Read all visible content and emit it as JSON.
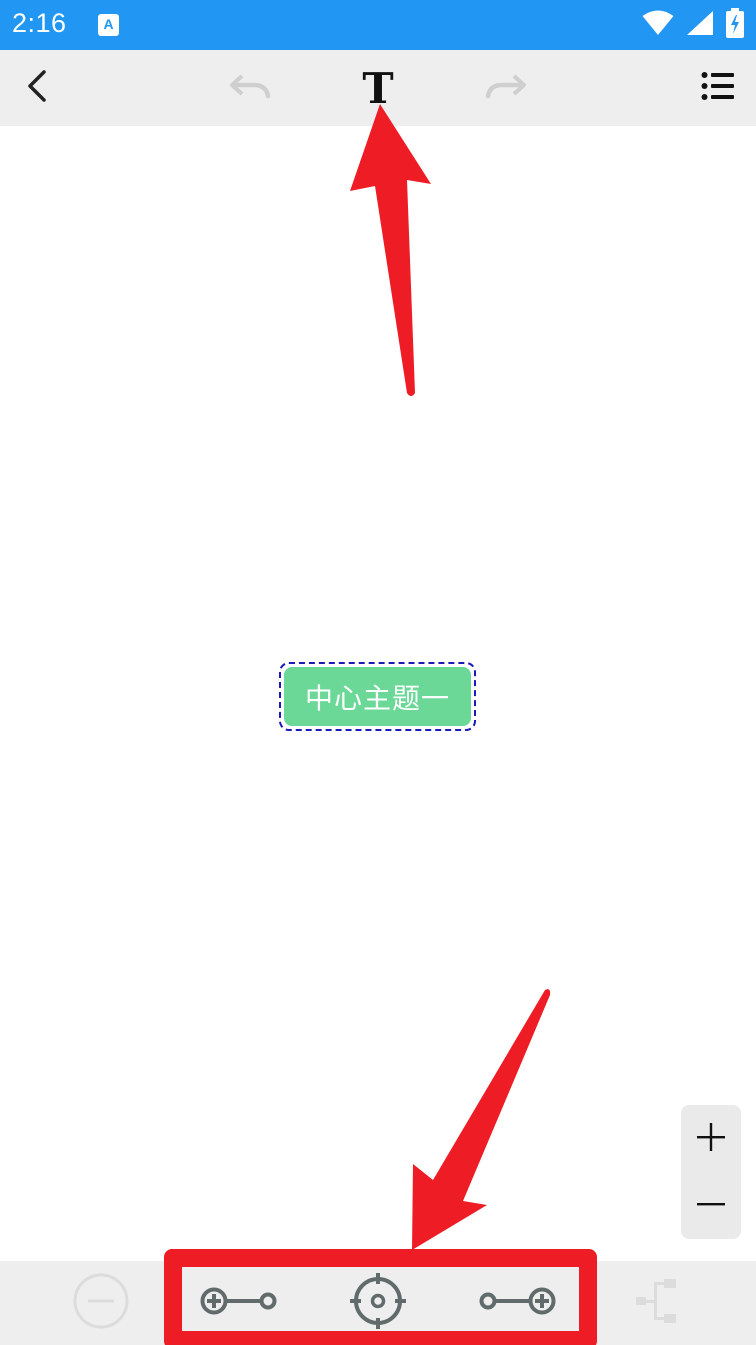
{
  "status_bar": {
    "time": "2:16",
    "app_icon_letter": "A",
    "icons": [
      "wifi-icon",
      "signal-icon",
      "battery-charging-icon"
    ],
    "background": "#2196f3"
  },
  "toolbar": {
    "buttons": [
      "back-icon",
      "undo-icon",
      "text-style-icon",
      "redo-icon",
      "outline-list-icon"
    ],
    "text_style_glyph": "T",
    "background": "#eeeeee"
  },
  "canvas": {
    "central_topic": {
      "label": "中心主题一",
      "fill_color": "#6bd898",
      "selection_border_color": "#1a1ab8"
    }
  },
  "zoom": {
    "zoom_in_label": "+",
    "zoom_out_label": "−"
  },
  "bottom_bar": {
    "buttons": [
      "delete-node-icon",
      "add-child-node-icon",
      "locate-center-icon",
      "add-sibling-node-icon",
      "tree-layout-icon"
    ],
    "background": "#eeeeee"
  },
  "annotations": {
    "arrow_color": "#ee1c25",
    "highlight_color": "#ee1c25"
  }
}
